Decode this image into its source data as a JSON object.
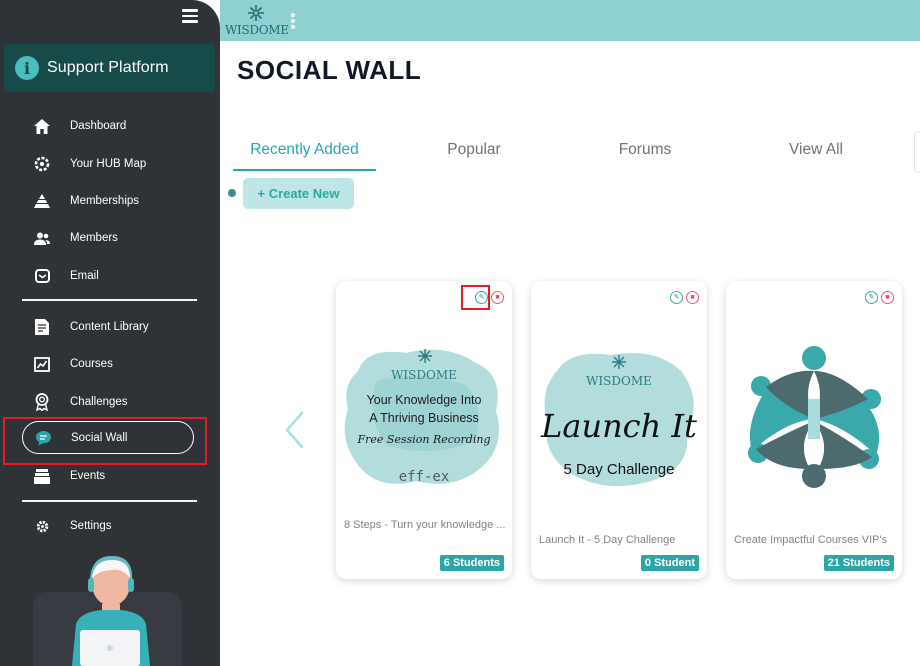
{
  "sidebar": {
    "brand": "Support Platform",
    "items": [
      {
        "label": "Dashboard",
        "icon": "home-icon"
      },
      {
        "label": "Your HUB Map",
        "icon": "gear-map-icon"
      },
      {
        "label": "Memberships",
        "icon": "pyramid-icon"
      },
      {
        "label": "Members",
        "icon": "users-icon"
      },
      {
        "label": "Email",
        "icon": "email-icon"
      },
      {
        "label": "Content Library",
        "icon": "document-icon"
      },
      {
        "label": "Courses",
        "icon": "chart-board-icon"
      },
      {
        "label": "Challenges",
        "icon": "award-icon"
      },
      {
        "label": "Social Wall",
        "icon": "chat-bubble-icon"
      },
      {
        "label": "Events",
        "icon": "calendar-stack-icon"
      },
      {
        "label": "Settings",
        "icon": "gear-icon"
      }
    ],
    "active_item": "Social Wall"
  },
  "topbar": {
    "logo_text": "WISDOME"
  },
  "main": {
    "title": "SOCIAL WALL",
    "tabs": [
      {
        "label": "Recently Added"
      },
      {
        "label": "Popular"
      },
      {
        "label": "Forums"
      },
      {
        "label": "View All"
      }
    ],
    "active_tab": "Recently Added",
    "create_button": "+ Create New",
    "cards": [
      {
        "title": "8 Steps - Turn your knowledge ...",
        "students": "6 Students",
        "image_lines": [
          "WISDOME",
          "Your Knowledge Into",
          "A Thriving Business",
          "Free Session Recording",
          "eff-ex"
        ]
      },
      {
        "title": "Launch It - 5 Day Challenge",
        "students": "0 Student",
        "image_lines": [
          "WISDOME",
          "Launch It",
          "5 Day Challenge"
        ]
      },
      {
        "title": "Create Impactful Courses VIP's",
        "students": "21 Students",
        "image_lines": []
      }
    ]
  },
  "colors": {
    "accent": "#2aa6a8",
    "sidebar_bg": "#2f3237",
    "topbar_bg": "#8fd0d1",
    "brand_bg": "#164b4a",
    "highlight": "#e11d2a"
  }
}
